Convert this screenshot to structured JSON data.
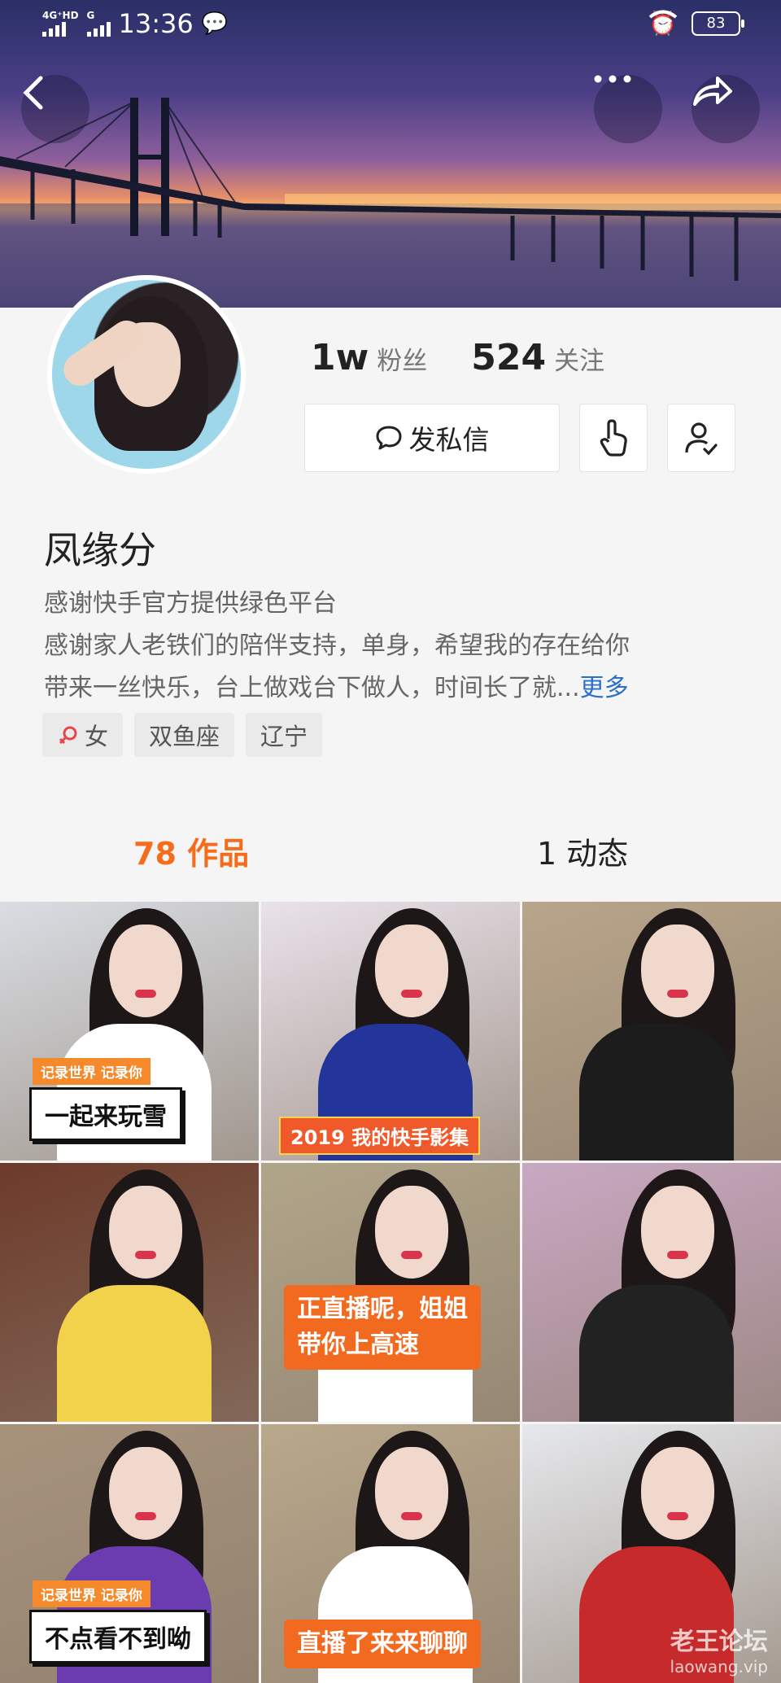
{
  "status_bar": {
    "network": "4G⁺HD",
    "network2": "G",
    "time": "13:36",
    "battery": "83"
  },
  "profile": {
    "followers_count": "1w",
    "followers_label": "粉丝",
    "following_count": "524",
    "following_label": "关注",
    "message_button": "发私信",
    "name": "凤缘分",
    "bio_line1": "感谢快手官方提供绿色平台",
    "bio_line2": "感谢家人老铁们的陪伴支持，单身，希望我的存在给你",
    "bio_line3": "带来一丝快乐，台上做戏台下做人，时间长了就...",
    "bio_more": "更多",
    "tags": [
      "女",
      "双鱼座",
      "辽宁"
    ]
  },
  "tabs": {
    "works": "78 作品",
    "moments": "1 动态"
  },
  "grid": [
    {
      "bg": "#d9dde3",
      "caption_sub": "记录世界 记录你",
      "caption": "一起来玩雪",
      "style": "white"
    },
    {
      "bg": "#e9e2ea",
      "caption_year": "2019 我的快手影集",
      "style": "year"
    },
    {
      "bg": "#b8a58a",
      "style": "none"
    },
    {
      "bg": "#6d3a2a",
      "style": "none"
    },
    {
      "bg": "#b1a589",
      "caption": "正直播呢，姐姐\n带你上高速",
      "style": "orange"
    },
    {
      "bg": "#c9a8c2",
      "style": "none"
    },
    {
      "bg": "#a7937c",
      "caption_sub": "记录世界 记录你",
      "caption": "不点看不到呦",
      "style": "white"
    },
    {
      "bg": "#b9a88b",
      "caption": "直播了来来聊聊",
      "style": "orange"
    },
    {
      "bg": "#e6e8ec",
      "style": "none"
    }
  ],
  "watermark": {
    "line1": "老王论坛",
    "line2": "laowang.vip"
  }
}
